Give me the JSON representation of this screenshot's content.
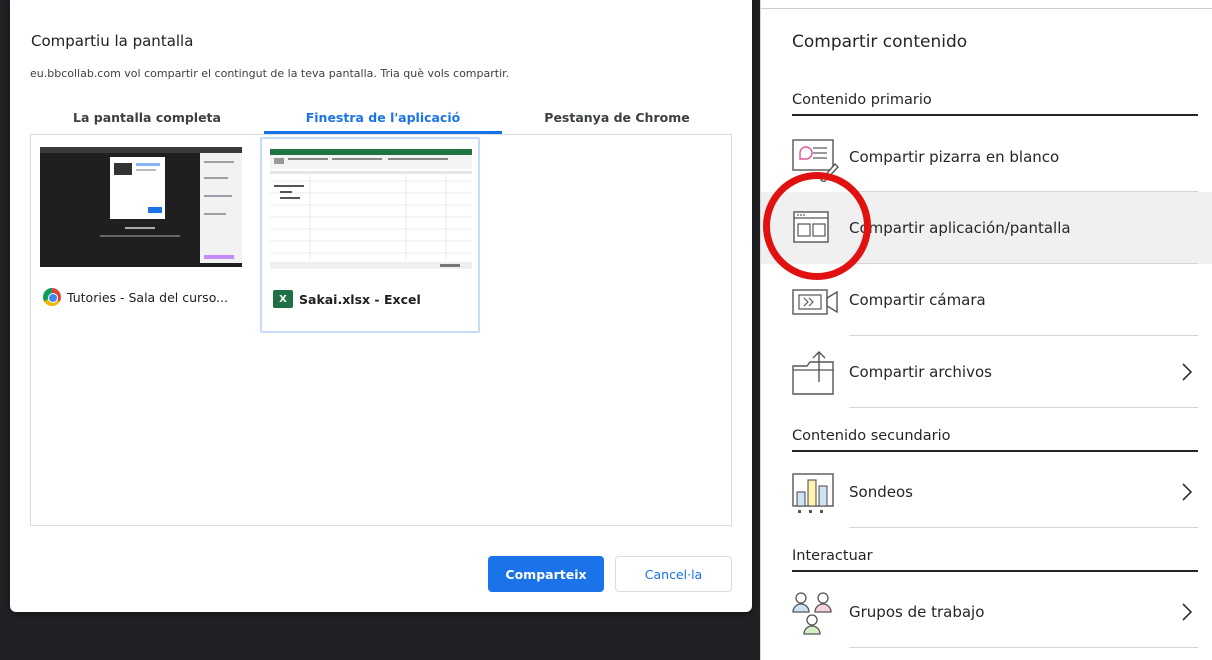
{
  "dialog": {
    "title": "Compartiu la pantalla",
    "subtitle": "eu.bbcollab.com vol compartir el contingut de la teva pantalla. Tria què vols compartir.",
    "tabs": [
      {
        "label": "La pantalla completa"
      },
      {
        "label": "Finestra de l'aplicació"
      },
      {
        "label": "Pestanya de Chrome"
      }
    ],
    "windows": [
      {
        "label": "Tutories - Sala del curso..."
      },
      {
        "label": "Sakai.xlsx - Excel"
      }
    ],
    "share_label": "Comparteix",
    "cancel_label": "Cancel·la"
  },
  "panel": {
    "title": "Compartir contenido",
    "sections": {
      "primary": "Contenido primario",
      "secondary": "Contenido secundario",
      "interact": "Interactuar"
    },
    "items": {
      "whiteboard": "Compartir pizarra en blanco",
      "app_screen": "Compartir aplicación/pantalla",
      "camera": "Compartir cámara",
      "files": "Compartir archivos",
      "polls": "Sondeos",
      "groups": "Grupos de trabajo"
    }
  },
  "colors": {
    "accent": "#1a73e8",
    "highlight": "#e21111",
    "excel": "#1e7145"
  }
}
